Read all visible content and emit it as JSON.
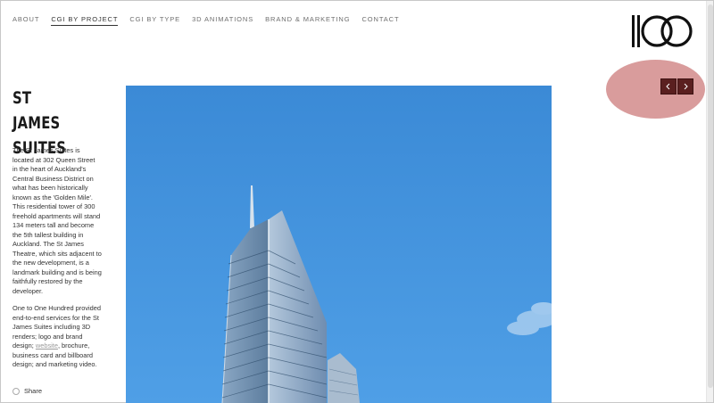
{
  "nav": {
    "items": [
      {
        "label": "ABOUT",
        "active": false
      },
      {
        "label": "CGI BY PROJECT",
        "active": true
      },
      {
        "label": "CGI BY TYPE",
        "active": false
      },
      {
        "label": "3D ANIMATIONS",
        "active": false
      },
      {
        "label": "BRAND & MARKETING",
        "active": false
      },
      {
        "label": "CONTACT",
        "active": false
      }
    ]
  },
  "logo": {
    "icon": "1oo-logo"
  },
  "project": {
    "title_line1": "ST JAMES",
    "title_line2": "SUITES",
    "description_1": "The St James Suites is located at 302 Queen Street in the heart of Auckland's Central Business District on what has been historically known as the 'Golden Mile'. This residential tower of 300 freehold apartments will stand 134 meters tall and become the 5th tallest building in Auckland. The St James Theatre, which sits adjacent to the new development, is a landmark building and is being faithfully restored by the developer.",
    "description_2_before": "One to One Hundred provided end-to-end services for the St James Suites including 3D renders; logo and brand design; ",
    "description_2_link": "website",
    "description_2_after": ", brochure, business card and billboard design;  and marketing video.",
    "share_label": "Share"
  },
  "slider": {
    "prev_icon": "chevron-left-icon",
    "next_icon": "chevron-right-icon"
  },
  "colors": {
    "accent": "#5a1f1f",
    "highlight": "#d69494",
    "sky": "#3f8fd8"
  }
}
